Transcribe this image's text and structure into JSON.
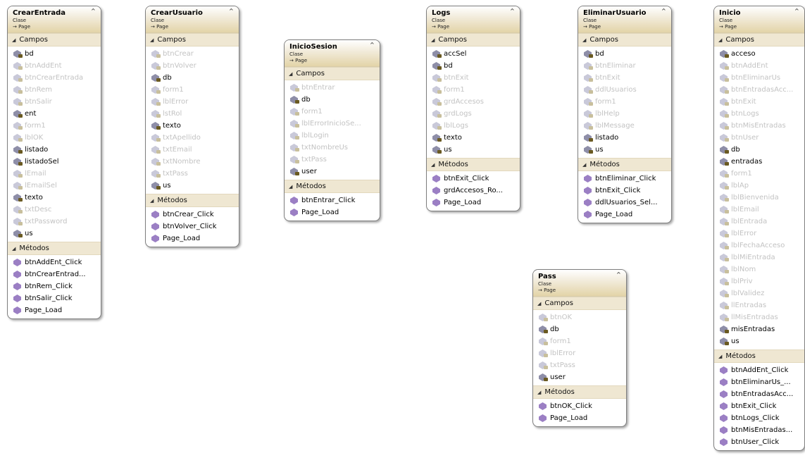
{
  "classes": [
    {
      "name": "CrearEntrada",
      "type": "Clase",
      "base": "→ Page",
      "fields_header": "Campos",
      "methods_header": "Métodos",
      "fields": [
        {
          "label": "bd",
          "private": false
        },
        {
          "label": "btnAddEnt",
          "private": true
        },
        {
          "label": "btnCrearEntrada",
          "private": true
        },
        {
          "label": "btnRem",
          "private": true
        },
        {
          "label": "btnSalir",
          "private": true
        },
        {
          "label": "ent",
          "private": false
        },
        {
          "label": "form1",
          "private": true
        },
        {
          "label": "lblOK",
          "private": true
        },
        {
          "label": "listado",
          "private": false
        },
        {
          "label": "listadoSel",
          "private": false
        },
        {
          "label": "lEmail",
          "private": true
        },
        {
          "label": "lEmailSel",
          "private": true
        },
        {
          "label": "texto",
          "private": false
        },
        {
          "label": "txtDesc",
          "private": true
        },
        {
          "label": "txtPassword",
          "private": true
        },
        {
          "label": "us",
          "private": false
        }
      ],
      "methods": [
        "btnAddEnt_Click",
        "btnCrearEntrad...",
        "btnRem_Click",
        "btnSalir_Click",
        "Page_Load"
      ]
    },
    {
      "name": "CrearUsuario",
      "type": "Clase",
      "base": "→ Page",
      "fields_header": "Campos",
      "methods_header": "Métodos",
      "fields": [
        {
          "label": "btnCrear",
          "private": true
        },
        {
          "label": "btnVolver",
          "private": true
        },
        {
          "label": "db",
          "private": false
        },
        {
          "label": "form1",
          "private": true
        },
        {
          "label": "lblError",
          "private": true
        },
        {
          "label": "lstRol",
          "private": true
        },
        {
          "label": "texto",
          "private": false
        },
        {
          "label": "txtApellido",
          "private": true
        },
        {
          "label": "txtEmail",
          "private": true
        },
        {
          "label": "txtNombre",
          "private": true
        },
        {
          "label": "txtPass",
          "private": true
        },
        {
          "label": "us",
          "private": false
        }
      ],
      "methods": [
        "btnCrear_Click",
        "btnVolver_Click",
        "Page_Load"
      ]
    },
    {
      "name": "InicioSesion",
      "type": "Clase",
      "base": "→ Page",
      "fields_header": "Campos",
      "methods_header": "Métodos",
      "fields": [
        {
          "label": "btnEntrar",
          "private": true
        },
        {
          "label": "db",
          "private": false
        },
        {
          "label": "form1",
          "private": true
        },
        {
          "label": "lblErrorInicioSe...",
          "private": true
        },
        {
          "label": "lblLogin",
          "private": true
        },
        {
          "label": "txtNombreUs",
          "private": true
        },
        {
          "label": "txtPass",
          "private": true
        },
        {
          "label": "user",
          "private": false
        }
      ],
      "methods": [
        "btnEntrar_Click",
        "Page_Load"
      ]
    },
    {
      "name": "Logs",
      "type": "Clase",
      "base": "→ Page",
      "fields_header": "Campos",
      "methods_header": "Métodos",
      "fields": [
        {
          "label": "accSel",
          "private": false
        },
        {
          "label": "bd",
          "private": false
        },
        {
          "label": "btnExit",
          "private": true
        },
        {
          "label": "form1",
          "private": true
        },
        {
          "label": "grdAccesos",
          "private": true
        },
        {
          "label": "grdLogs",
          "private": true
        },
        {
          "label": "lblLogs",
          "private": true
        },
        {
          "label": "texto",
          "private": false
        },
        {
          "label": "us",
          "private": false
        }
      ],
      "methods": [
        "btnExit_Click",
        "grdAccesos_Ro...",
        "Page_Load"
      ]
    },
    {
      "name": "EliminarUsuario",
      "type": "Clase",
      "base": "→ Page",
      "fields_header": "Campos",
      "methods_header": "Métodos",
      "fields": [
        {
          "label": "bd",
          "private": false
        },
        {
          "label": "btnEliminar",
          "private": true
        },
        {
          "label": "btnExit",
          "private": true
        },
        {
          "label": "ddlUsuarios",
          "private": true
        },
        {
          "label": "form1",
          "private": true
        },
        {
          "label": "lblHelp",
          "private": true
        },
        {
          "label": "lblMessage",
          "private": true
        },
        {
          "label": "listado",
          "private": false
        },
        {
          "label": "us",
          "private": false
        }
      ],
      "methods": [
        "btnEliminar_Click",
        "btnExit_Click",
        "ddlUsuarios_Sel...",
        "Page_Load"
      ]
    },
    {
      "name": "Inicio",
      "type": "Clase",
      "base": "→ Page",
      "fields_header": "Campos",
      "methods_header": "Métodos",
      "fields": [
        {
          "label": "acceso",
          "private": false
        },
        {
          "label": "btnAddEnt",
          "private": true
        },
        {
          "label": "btnEliminarUs",
          "private": true
        },
        {
          "label": "btnEntradasAcc...",
          "private": true
        },
        {
          "label": "btnExit",
          "private": true
        },
        {
          "label": "btnLogs",
          "private": true
        },
        {
          "label": "btnMisEntradas",
          "private": true
        },
        {
          "label": "btnUser",
          "private": true
        },
        {
          "label": "db",
          "private": false
        },
        {
          "label": "entradas",
          "private": false
        },
        {
          "label": "form1",
          "private": true
        },
        {
          "label": "lblAp",
          "private": true
        },
        {
          "label": "lblBienvenida",
          "private": true
        },
        {
          "label": "lblEmail",
          "private": true
        },
        {
          "label": "lblEntrada",
          "private": true
        },
        {
          "label": "lblError",
          "private": true
        },
        {
          "label": "lblFechaAcceso",
          "private": true
        },
        {
          "label": "lblMiEntrada",
          "private": true
        },
        {
          "label": "lblNom",
          "private": true
        },
        {
          "label": "lblPriv",
          "private": true
        },
        {
          "label": "lblValidez",
          "private": true
        },
        {
          "label": "llEntradas",
          "private": true
        },
        {
          "label": "llMisEntradas",
          "private": true
        },
        {
          "label": "misEntradas",
          "private": false
        },
        {
          "label": "us",
          "private": false
        }
      ],
      "methods": [
        "btnAddEnt_Click",
        "btnEliminarUs_...",
        "btnEntradasAcc...",
        "btnExit_Click",
        "btnLogs_Click",
        "btnMisEntradas...",
        "btnUser_Click"
      ]
    },
    {
      "name": "Pass",
      "type": "Clase",
      "base": "→ Page",
      "fields_header": "Campos",
      "methods_header": "Métodos",
      "fields": [
        {
          "label": "btnOK",
          "private": true
        },
        {
          "label": "db",
          "private": false
        },
        {
          "label": "form1",
          "private": true
        },
        {
          "label": "lblError",
          "private": true
        },
        {
          "label": "txtPass",
          "private": true
        },
        {
          "label": "user",
          "private": false
        }
      ],
      "methods": [
        "btnOK_Click",
        "Page_Load"
      ]
    }
  ]
}
